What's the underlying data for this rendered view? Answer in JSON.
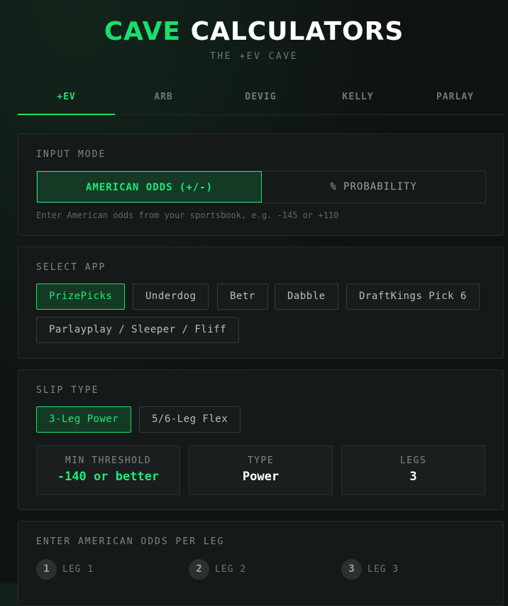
{
  "header": {
    "title_accent": "CAVE",
    "title_rest": "CALCULATORS",
    "subtitle": "THE +EV CAVE"
  },
  "tabs": [
    {
      "label": "+EV",
      "active": true
    },
    {
      "label": "ARB",
      "active": false
    },
    {
      "label": "DEVIG",
      "active": false
    },
    {
      "label": "KELLY",
      "active": false
    },
    {
      "label": "PARLAY",
      "active": false
    }
  ],
  "input_mode": {
    "label": "INPUT MODE",
    "options": [
      "AMERICAN ODDS (+/-)",
      "% PROBABILITY"
    ],
    "selected": "AMERICAN ODDS (+/-)",
    "hint": "Enter American odds from your sportsbook, e.g. -145 or +110"
  },
  "select_app": {
    "label": "SELECT APP",
    "apps": [
      "PrizePicks",
      "Underdog",
      "Betr",
      "Dabble",
      "DraftKings Pick 6",
      "Parlayplay / Sleeper / Fliff"
    ],
    "selected": "PrizePicks"
  },
  "slip_type": {
    "label": "SLIP TYPE",
    "options": [
      "3-Leg Power",
      "5/6-Leg Flex"
    ],
    "selected": "3-Leg Power",
    "stats": {
      "min_threshold_label": "MIN THRESHOLD",
      "min_threshold_value": "-140 or better",
      "type_label": "TYPE",
      "type_value": "Power",
      "legs_label": "LEGS",
      "legs_value": "3"
    }
  },
  "odds_entry": {
    "label": "ENTER AMERICAN ODDS PER LEG",
    "legs": [
      {
        "number": "1",
        "label": "LEG 1"
      },
      {
        "number": "2",
        "label": "LEG 2"
      },
      {
        "number": "3",
        "label": "LEG 3"
      }
    ]
  },
  "colors": {
    "accent": "#19e06d",
    "background": "#0f1212",
    "card": "#151919",
    "active_fill": "#143a26"
  }
}
